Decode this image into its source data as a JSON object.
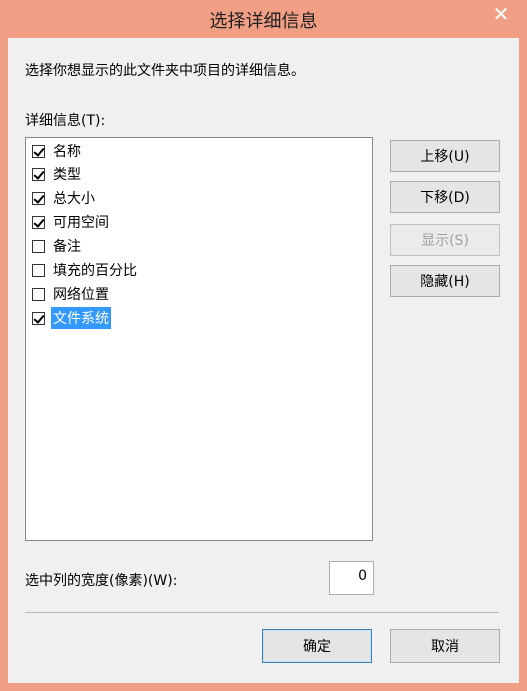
{
  "window": {
    "title": "选择详细信息",
    "close_glyph": "✕"
  },
  "description": "选择你想显示的此文件夹中项目的详细信息。",
  "details_label": "详细信息(T):",
  "items": [
    {
      "label": "名称",
      "checked": true,
      "selected": false
    },
    {
      "label": "类型",
      "checked": true,
      "selected": false
    },
    {
      "label": "总大小",
      "checked": true,
      "selected": false
    },
    {
      "label": "可用空间",
      "checked": true,
      "selected": false
    },
    {
      "label": "备注",
      "checked": false,
      "selected": false
    },
    {
      "label": "填充的百分比",
      "checked": false,
      "selected": false
    },
    {
      "label": "网络位置",
      "checked": false,
      "selected": false
    },
    {
      "label": "文件系统",
      "checked": true,
      "selected": true
    }
  ],
  "buttons": {
    "move_up": "上移(U)",
    "move_down": "下移(D)",
    "show": "显示(S)",
    "hide": "隐藏(H)",
    "ok": "确定",
    "cancel": "取消"
  },
  "width_label": "选中列的宽度(像素)(W):",
  "width_value": "0",
  "icons": {
    "close": "close-icon",
    "checkbox": "checkbox-icon"
  }
}
